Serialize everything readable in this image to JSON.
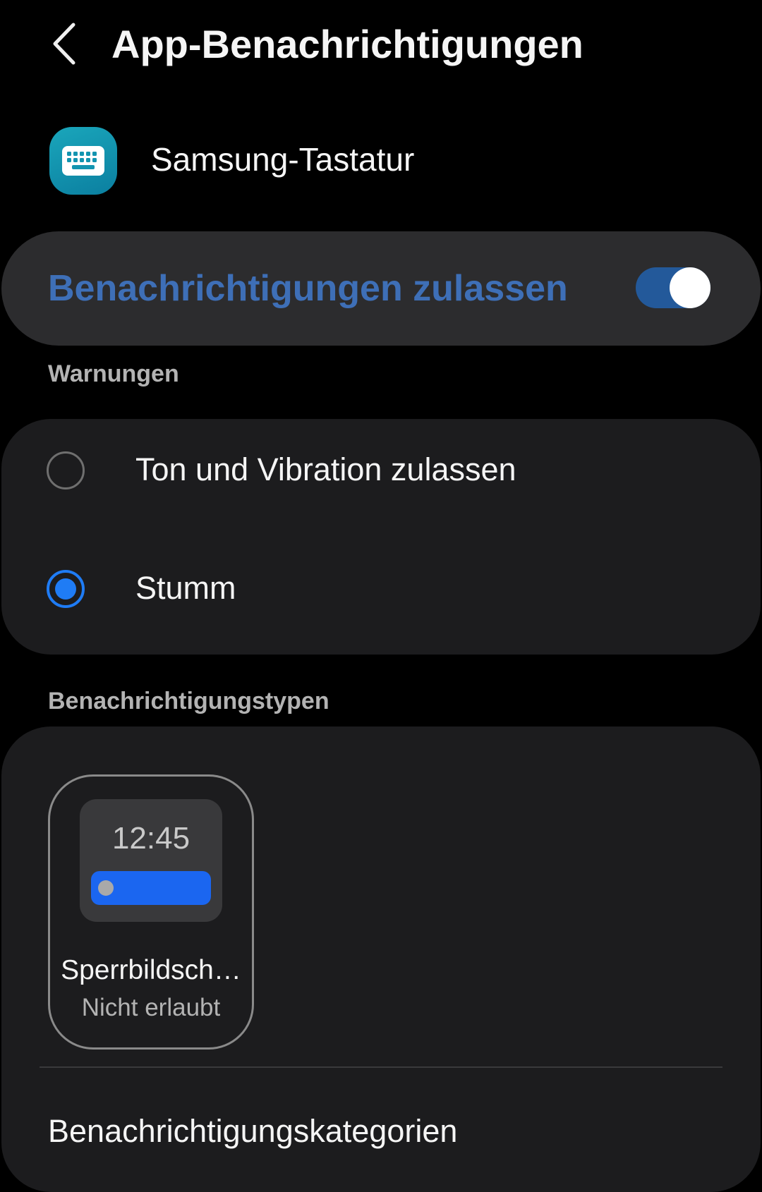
{
  "header": {
    "title": "App-Benachrichtigungen",
    "back_icon": "chevron-left-icon"
  },
  "app": {
    "name": "Samsung-Tastatur",
    "icon": "keyboard-icon"
  },
  "master_toggle": {
    "label": "Benachrichtigungen zulassen",
    "on": true,
    "accent_color": "#3e6fb7"
  },
  "alerts": {
    "section_label": "Warnungen",
    "options": [
      {
        "label": "Ton und Vibration zulassen",
        "selected": false
      },
      {
        "label": "Stumm",
        "selected": true
      }
    ],
    "accent_color": "#1f7cf5"
  },
  "types": {
    "section_label": "Benachrichtigungstypen",
    "lock_screen": {
      "preview_time": "12:45",
      "title": "Sperrbildsch…",
      "status": "Nicht erlaubt"
    },
    "categories_label": "Benachrichtigungskategorien"
  }
}
